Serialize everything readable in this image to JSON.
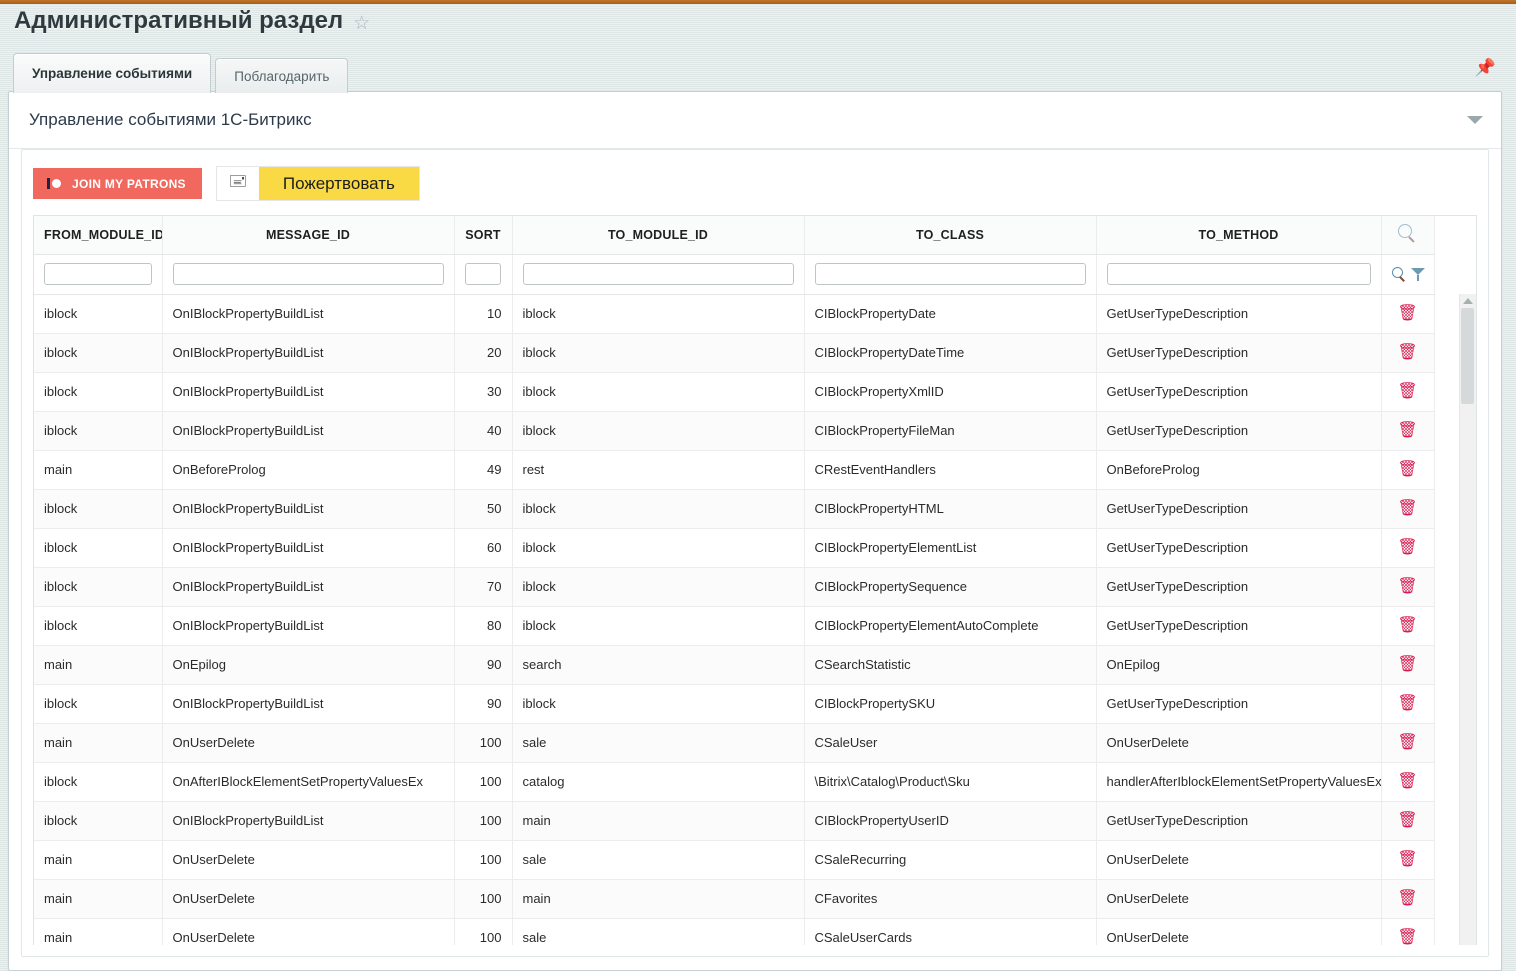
{
  "top_accent_color": "#b4691f",
  "header": {
    "page_title": "Административный раздел",
    "star_icon": "star-icon",
    "pin_icon": "pin-icon"
  },
  "tabs": [
    {
      "label": "Управление событиями",
      "active": true
    },
    {
      "label": "Поблагодарить",
      "active": false
    }
  ],
  "panel": {
    "title": "Управление событиями 1С-Битрикс",
    "collapse_icon": "chevron-down-icon"
  },
  "toolbar": {
    "patreon_label": "JOIN MY PATRONS",
    "patreon_color": "#f1685e",
    "card_icon": "credit-card-icon",
    "donate_label": "Пожертвовать",
    "donate_color": "#fada44"
  },
  "table": {
    "columns": [
      {
        "key": "from_module_id",
        "label": "FROM_MODULE_ID"
      },
      {
        "key": "message_id",
        "label": "MESSAGE_ID"
      },
      {
        "key": "sort",
        "label": "SORT"
      },
      {
        "key": "to_module_id",
        "label": "TO_MODULE_ID"
      },
      {
        "key": "to_class",
        "label": "TO_CLASS"
      },
      {
        "key": "to_method",
        "label": "TO_METHOD"
      },
      {
        "key": "actions",
        "label": ""
      }
    ],
    "header_search_icon": "search-icon",
    "filters": {
      "from_module_id": "",
      "message_id": "",
      "sort": "",
      "to_module_id": "",
      "to_class": "",
      "to_method": "",
      "search_icon": "search-icon",
      "filter_icon": "funnel-icon"
    },
    "row_action_icon": "trash-icon",
    "rows": [
      {
        "from_module_id": "iblock",
        "message_id": "OnIBlockPropertyBuildList",
        "sort": "10",
        "to_module_id": "iblock",
        "to_class": "CIBlockPropertyDate",
        "to_method": "GetUserTypeDescription"
      },
      {
        "from_module_id": "iblock",
        "message_id": "OnIBlockPropertyBuildList",
        "sort": "20",
        "to_module_id": "iblock",
        "to_class": "CIBlockPropertyDateTime",
        "to_method": "GetUserTypeDescription"
      },
      {
        "from_module_id": "iblock",
        "message_id": "OnIBlockPropertyBuildList",
        "sort": "30",
        "to_module_id": "iblock",
        "to_class": "CIBlockPropertyXmlID",
        "to_method": "GetUserTypeDescription"
      },
      {
        "from_module_id": "iblock",
        "message_id": "OnIBlockPropertyBuildList",
        "sort": "40",
        "to_module_id": "iblock",
        "to_class": "CIBlockPropertyFileMan",
        "to_method": "GetUserTypeDescription"
      },
      {
        "from_module_id": "main",
        "message_id": "OnBeforeProlog",
        "sort": "49",
        "to_module_id": "rest",
        "to_class": "CRestEventHandlers",
        "to_method": "OnBeforeProlog"
      },
      {
        "from_module_id": "iblock",
        "message_id": "OnIBlockPropertyBuildList",
        "sort": "50",
        "to_module_id": "iblock",
        "to_class": "CIBlockPropertyHTML",
        "to_method": "GetUserTypeDescription"
      },
      {
        "from_module_id": "iblock",
        "message_id": "OnIBlockPropertyBuildList",
        "sort": "60",
        "to_module_id": "iblock",
        "to_class": "CIBlockPropertyElementList",
        "to_method": "GetUserTypeDescription"
      },
      {
        "from_module_id": "iblock",
        "message_id": "OnIBlockPropertyBuildList",
        "sort": "70",
        "to_module_id": "iblock",
        "to_class": "CIBlockPropertySequence",
        "to_method": "GetUserTypeDescription"
      },
      {
        "from_module_id": "iblock",
        "message_id": "OnIBlockPropertyBuildList",
        "sort": "80",
        "to_module_id": "iblock",
        "to_class": "CIBlockPropertyElementAutoComplete",
        "to_method": "GetUserTypeDescription"
      },
      {
        "from_module_id": "main",
        "message_id": "OnEpilog",
        "sort": "90",
        "to_module_id": "search",
        "to_class": "CSearchStatistic",
        "to_method": "OnEpilog"
      },
      {
        "from_module_id": "iblock",
        "message_id": "OnIBlockPropertyBuildList",
        "sort": "90",
        "to_module_id": "iblock",
        "to_class": "CIBlockPropertySKU",
        "to_method": "GetUserTypeDescription"
      },
      {
        "from_module_id": "main",
        "message_id": "OnUserDelete",
        "sort": "100",
        "to_module_id": "sale",
        "to_class": "CSaleUser",
        "to_method": "OnUserDelete"
      },
      {
        "from_module_id": "iblock",
        "message_id": "OnAfterIBlockElementSetPropertyValuesEx",
        "sort": "100",
        "to_module_id": "catalog",
        "to_class": "\\Bitrix\\Catalog\\Product\\Sku",
        "to_method": "handlerAfterIblockElementSetPropertyValuesEx"
      },
      {
        "from_module_id": "iblock",
        "message_id": "OnIBlockPropertyBuildList",
        "sort": "100",
        "to_module_id": "main",
        "to_class": "CIBlockPropertyUserID",
        "to_method": "GetUserTypeDescription"
      },
      {
        "from_module_id": "main",
        "message_id": "OnUserDelete",
        "sort": "100",
        "to_module_id": "sale",
        "to_class": "CSaleRecurring",
        "to_method": "OnUserDelete"
      },
      {
        "from_module_id": "main",
        "message_id": "OnUserDelete",
        "sort": "100",
        "to_module_id": "main",
        "to_class": "CFavorites",
        "to_method": "OnUserDelete"
      },
      {
        "from_module_id": "main",
        "message_id": "OnUserDelete",
        "sort": "100",
        "to_module_id": "sale",
        "to_class": "CSaleUserCards",
        "to_method": "OnUserDelete"
      }
    ]
  },
  "scrollbar": {
    "up_arrow_icon": "scroll-up-arrow-icon"
  }
}
